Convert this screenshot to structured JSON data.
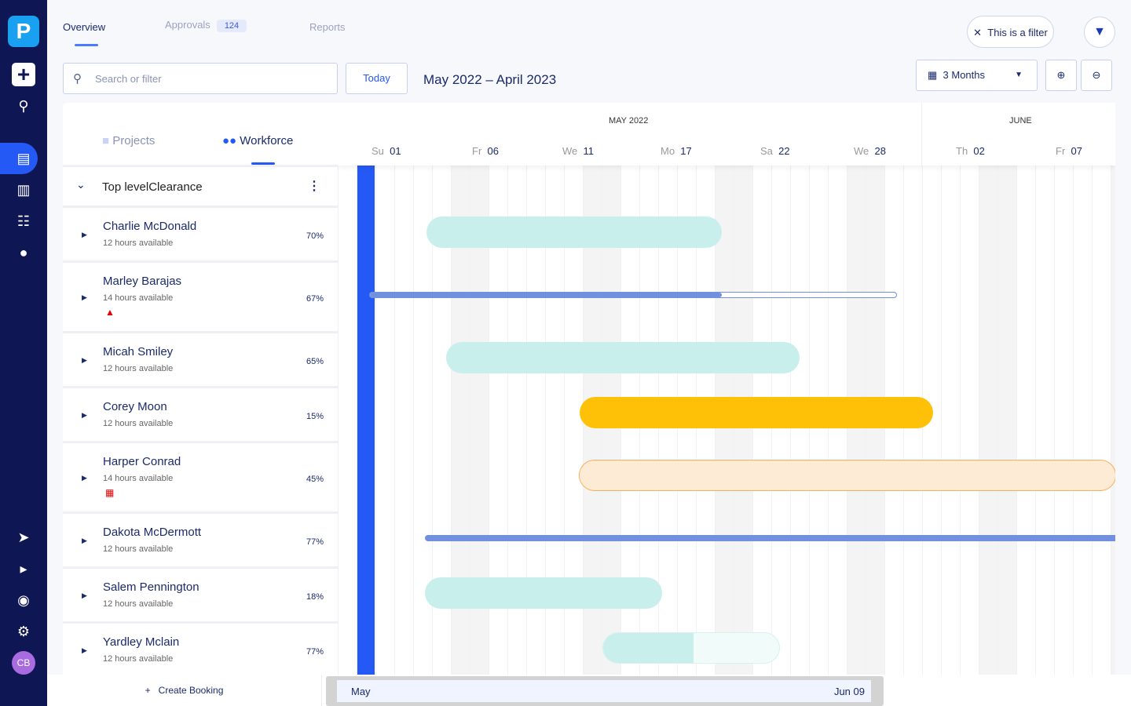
{
  "app": {
    "logo": "P",
    "avatar": "CB"
  },
  "tabs": [
    {
      "label": "Overview"
    },
    {
      "label": "Approvals",
      "badge": "124"
    },
    {
      "label": "Reports"
    }
  ],
  "search": {
    "placeholder": "Search or filter"
  },
  "today_label": "Today",
  "date_range": "May 2022 – April 2023",
  "filter_chip": "This is a filter",
  "period_select": "3 Months",
  "panel_tabs": {
    "projects": "Projects",
    "workforce": "Workforce"
  },
  "group": {
    "label": "Top levelClearance"
  },
  "people": [
    {
      "name": "Charlie McDonald",
      "hours": "12 hours available",
      "pct": "70%"
    },
    {
      "name": "Marley Barajas",
      "hours": "14 hours available",
      "pct": "67%",
      "alert": "warning"
    },
    {
      "name": "Micah Smiley",
      "hours": "12 hours available",
      "pct": "65%"
    },
    {
      "name": "Corey Moon",
      "hours": "12 hours available",
      "pct": "15%"
    },
    {
      "name": "Harper Conrad",
      "hours": "14 hours available",
      "pct": "45%",
      "alert": "calendar"
    },
    {
      "name": "Dakota McDermott",
      "hours": "12 hours available",
      "pct": "77%"
    },
    {
      "name": "Salem Pennington",
      "hours": "12 hours available",
      "pct": "18%"
    },
    {
      "name": "Yardley Mclain",
      "hours": "12 hours available",
      "pct": "77%"
    }
  ],
  "timeline": {
    "months": [
      "MAY 2022",
      "JUNE"
    ],
    "days": [
      {
        "d": "Su",
        "n": "01"
      },
      {
        "d": "Fr",
        "n": "06"
      },
      {
        "d": "We",
        "n": "11"
      },
      {
        "d": "Mo",
        "n": "17"
      },
      {
        "d": "Sa",
        "n": "22"
      },
      {
        "d": "We",
        "n": "28"
      },
      {
        "d": "Th",
        "n": "02"
      },
      {
        "d": "Fr",
        "n": "07"
      }
    ]
  },
  "create_booking": "Create Booking",
  "scrubber": {
    "start": "May",
    "end": "Jun 09"
  },
  "colors": {
    "accent": "#2459f5",
    "sidebar": "#0f1654",
    "teal": "#c9efec",
    "amber": "#ffc107",
    "peach": "#fdebd6"
  }
}
